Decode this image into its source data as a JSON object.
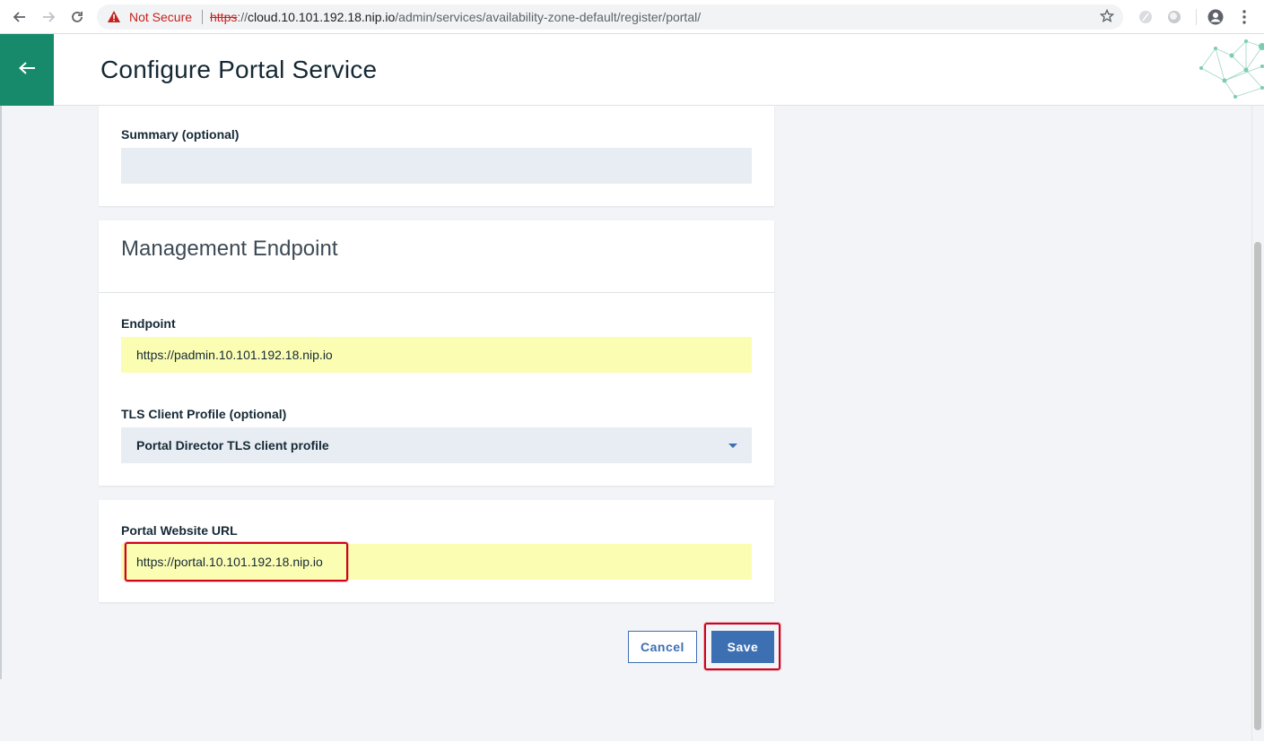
{
  "browser": {
    "security_label": "Not Secure",
    "url_scheme": "https",
    "url_sep": "://",
    "url_host": "cloud.10.101.192.18.nip.io",
    "url_path": "/admin/services/availability-zone-default/register/portal/"
  },
  "header": {
    "title": "Configure Portal Service",
    "accent_color": "#178a6b"
  },
  "summary": {
    "label": "Summary (optional)",
    "value": ""
  },
  "management": {
    "title": "Management Endpoint",
    "endpoint_label": "Endpoint",
    "endpoint_value": "https://padmin.10.101.192.18.nip.io",
    "tls_label": "TLS Client Profile (optional)",
    "tls_value": "Portal Director TLS client profile"
  },
  "portal": {
    "url_label": "Portal Website URL",
    "url_value": "https://portal.10.101.192.18.nip.io"
  },
  "actions": {
    "cancel_label": "Cancel",
    "save_label": "Save",
    "primary_color": "#3d70b2"
  }
}
